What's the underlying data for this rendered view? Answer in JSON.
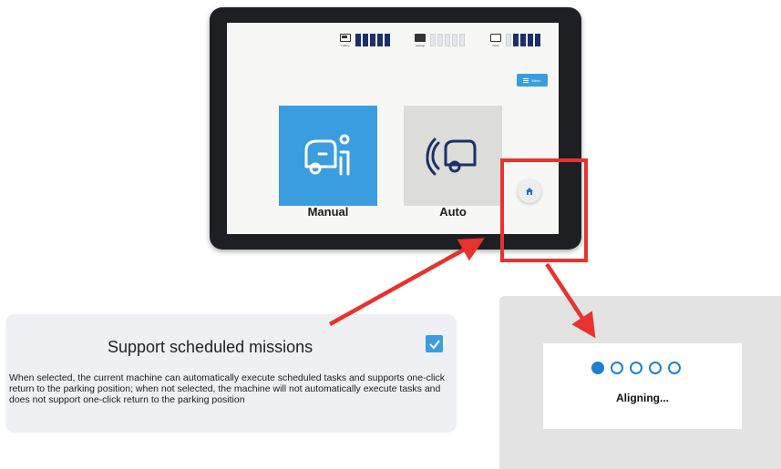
{
  "device": {
    "status": [
      {
        "name": "battery",
        "label": "battery",
        "filled": 5,
        "total": 5
      },
      {
        "name": "sewage",
        "label": "sewage",
        "filled": 0,
        "total": 5
      },
      {
        "name": "clean",
        "label": "clean",
        "filled": 4,
        "total": 5
      }
    ],
    "menu_label": "Menu",
    "modes": [
      {
        "name": "manual",
        "label": "Manual",
        "selected": true
      },
      {
        "name": "auto",
        "label": "Auto",
        "selected": false
      }
    ],
    "home_icon": "home-icon"
  },
  "settings": {
    "title": "Support scheduled missions",
    "checked": true,
    "description": "When selected, the current machine can automatically execute scheduled tasks and supports one-click return to the parking position; when not selected, the machine will not automatically execute tasks and does not support one-click return to the parking position"
  },
  "aligning": {
    "label": "Aligning...",
    "progress_dots": 5,
    "active_dot": 1
  },
  "colors": {
    "accent": "#3a9de0",
    "highlight": "#e8322f",
    "bar_fill": "#1b2f6b",
    "dot": "#1d7fd1"
  }
}
